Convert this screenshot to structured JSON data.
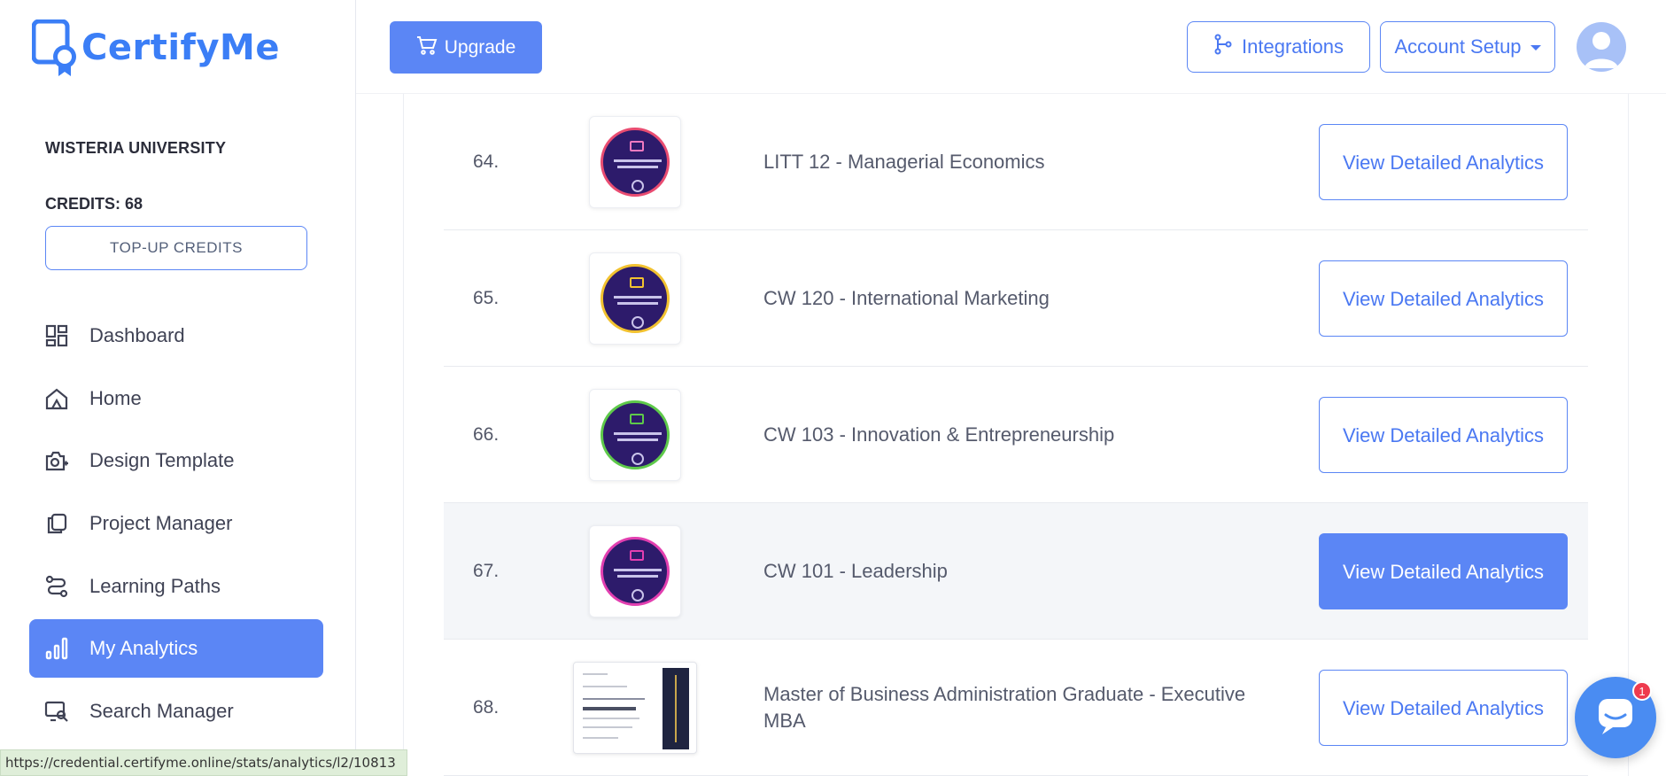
{
  "brand": {
    "name": "CertifyMe",
    "color": "#3b7ef6"
  },
  "sidebar": {
    "org_name": "WISTERIA UNIVERSITY",
    "credits": "CREDITS: 68",
    "topup_label": "TOP-UP CREDITS",
    "items": [
      {
        "label": "Dashboard",
        "icon": "dashboard-icon",
        "active": false
      },
      {
        "label": "Home",
        "icon": "home-icon",
        "active": false
      },
      {
        "label": "Design Template",
        "icon": "design-template-icon",
        "active": false
      },
      {
        "label": "Project Manager",
        "icon": "project-manager-icon",
        "active": false
      },
      {
        "label": "Learning Paths",
        "icon": "learning-paths-icon",
        "active": false
      },
      {
        "label": "My Analytics",
        "icon": "analytics-icon",
        "active": true
      },
      {
        "label": "Search Manager",
        "icon": "search-manager-icon",
        "active": false
      }
    ]
  },
  "topbar": {
    "upgrade_label": "Upgrade",
    "integrations_label": "Integrations",
    "account_label": "Account Setup"
  },
  "rows": [
    {
      "num": "64.",
      "title": "LITT 12 - Managerial Economics",
      "button": "View Detailed Analytics",
      "badge_ring": "#e94c71",
      "highlight": false,
      "type": "badge"
    },
    {
      "num": "65.",
      "title": "CW 120 - International Marketing",
      "button": "View Detailed Analytics",
      "badge_ring": "#f2c230",
      "highlight": false,
      "type": "badge"
    },
    {
      "num": "66.",
      "title": "CW 103 - Innovation & Entrepreneurship",
      "button": "View Detailed Analytics",
      "badge_ring": "#5ec94a",
      "highlight": false,
      "type": "badge"
    },
    {
      "num": "67.",
      "title": "CW 101 -  Leadership",
      "button": "View Detailed Analytics",
      "badge_ring": "#e23fb0",
      "highlight": true,
      "type": "badge"
    },
    {
      "num": "68.",
      "title": "Master of Business Administration Graduate - Executive MBA",
      "button": "View Detailed Analytics",
      "highlight": false,
      "type": "certificate"
    }
  ],
  "status_url": "https://credential.certifyme.online/stats/analytics/l2/10813",
  "chat": {
    "badge_count": "1"
  },
  "colors": {
    "accent": "#5b86f5",
    "highlight_row": "#f4f6f9"
  }
}
